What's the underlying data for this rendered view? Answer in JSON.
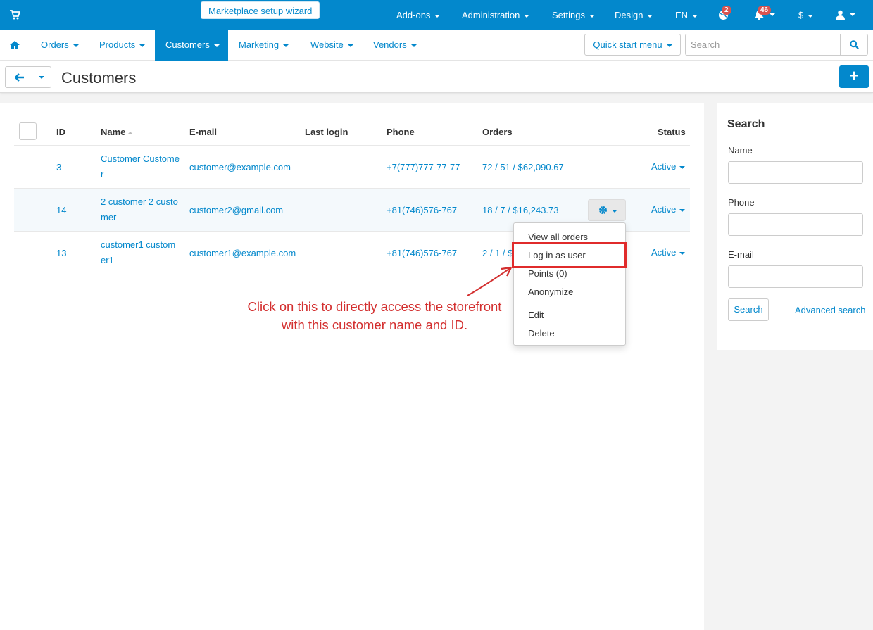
{
  "topbar": {
    "wizard": "Marketplace setup wizard",
    "menu": [
      "Add-ons",
      "Administration",
      "Settings",
      "Design",
      "EN"
    ],
    "currency": "$",
    "notifications_badge": "2",
    "alerts_badge": "46"
  },
  "nav": {
    "items": [
      "Orders",
      "Products",
      "Customers",
      "Marketing",
      "Website",
      "Vendors"
    ],
    "active": "Customers",
    "quick_start": "Quick start menu",
    "search_placeholder": "Search"
  },
  "page": {
    "title": "Customers"
  },
  "table": {
    "headers": {
      "id": "ID",
      "name": "Name",
      "email": "E-mail",
      "last_login": "Last login",
      "phone": "Phone",
      "orders": "Orders",
      "status": "Status"
    },
    "rows": [
      {
        "id": "3",
        "name": "Customer Customer",
        "email": "customer@example.com",
        "phone": "+7(777)777-77-77",
        "orders": [
          "72",
          "51",
          "$62,090.67"
        ],
        "status": "Active"
      },
      {
        "id": "14",
        "name": "2 customer 2 customer",
        "email": "customer2@gmail.com",
        "phone": "+81(746)576-767",
        "orders": [
          "18",
          "7",
          "$16,243.73"
        ],
        "status": "Active"
      },
      {
        "id": "13",
        "name": "customer1 customer1",
        "email": "customer1@example.com",
        "phone": "+81(746)576-767",
        "orders": [
          "2",
          "1",
          "$"
        ],
        "status": "Active"
      }
    ]
  },
  "dropdown": {
    "items": [
      "View all orders",
      "Log in as user",
      "Points (0)",
      "Anonymize",
      "Edit",
      "Delete"
    ]
  },
  "annotation": {
    "line1": "Click on this to directly access the  storefront",
    "line2": "with this customer name and ID."
  },
  "sidebar": {
    "title": "Search",
    "name_label": "Name",
    "phone_label": "Phone",
    "email_label": "E-mail",
    "search_button": "Search",
    "advanced": "Advanced search"
  },
  "colors": {
    "primary": "#0388cc",
    "badge": "#d9534f",
    "annotation": "#d32f2f"
  }
}
